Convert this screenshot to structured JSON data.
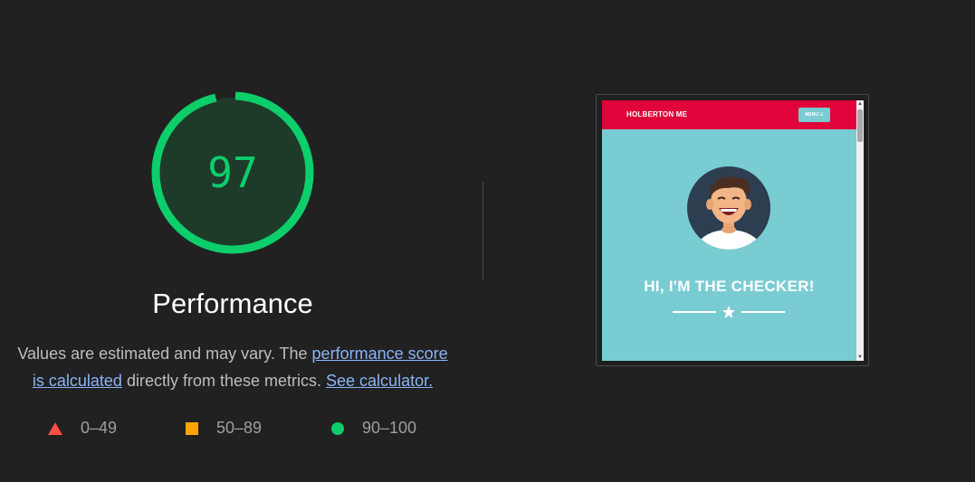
{
  "score": {
    "value": "97",
    "fraction": 0.97,
    "color": "#0cce6b"
  },
  "category": {
    "title": "Performance"
  },
  "description": {
    "text_before": "Values are estimated and may vary. The ",
    "link1": "performance score is calculated",
    "text_middle": " directly from these metrics. ",
    "link2": "See calculator."
  },
  "legend": {
    "items": [
      {
        "range": "0–49",
        "shape": "triangle-icon",
        "color": "#ff4e42"
      },
      {
        "range": "50–89",
        "shape": "square-icon",
        "color": "#ffa400"
      },
      {
        "range": "90–100",
        "shape": "circle-icon",
        "color": "#0cce6b"
      }
    ]
  },
  "preview": {
    "site_brand": "HOLBERTON ME",
    "menu_label": "MENU ☰",
    "hero_title": "HI, I'M THE CHECKER!",
    "nav_color": "#e0043b",
    "bg_color": "#7accd3"
  }
}
